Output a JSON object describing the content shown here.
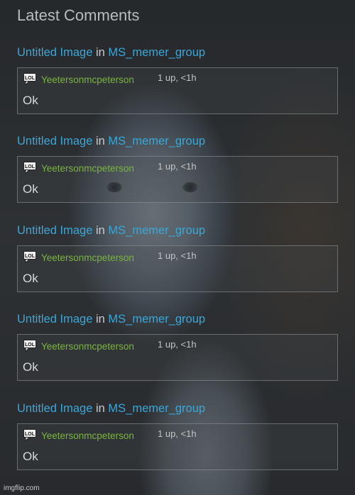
{
  "heading": "Latest Comments",
  "comments": [
    {
      "post": "Untitled Image",
      "in_word": "in",
      "group": "MS_memer_group",
      "badge": "LOL",
      "user": "Yeetersonmcpeterson",
      "meta": "1 up, <1h",
      "text": "Ok"
    },
    {
      "post": "Untitled Image",
      "in_word": "in",
      "group": "MS_memer_group",
      "badge": "LOL",
      "user": "Yeetersonmcpeterson",
      "meta": "1 up, <1h",
      "text": "Ok"
    },
    {
      "post": "Untitled Image",
      "in_word": "in",
      "group": "MS_memer_group",
      "badge": "LOL",
      "user": "Yeetersonmcpeterson",
      "meta": "1 up, <1h",
      "text": "Ok"
    },
    {
      "post": "Untitled Image",
      "in_word": "in",
      "group": "MS_memer_group",
      "badge": "LOL",
      "user": "Yeetersonmcpeterson",
      "meta": "1 up, <1h",
      "text": "Ok"
    },
    {
      "post": "Untitled Image",
      "in_word": "in",
      "group": "MS_memer_group",
      "badge": "LOL",
      "user": "Yeetersonmcpeterson",
      "meta": "1 up, <1h",
      "text": "Ok"
    }
  ],
  "watermark": "imgflip.com",
  "colors": {
    "link": "#3aa7d8",
    "username": "#7cb342",
    "heading": "#b9bcbf"
  },
  "icons": {
    "badge": "lol-speech-bubble-icon"
  }
}
